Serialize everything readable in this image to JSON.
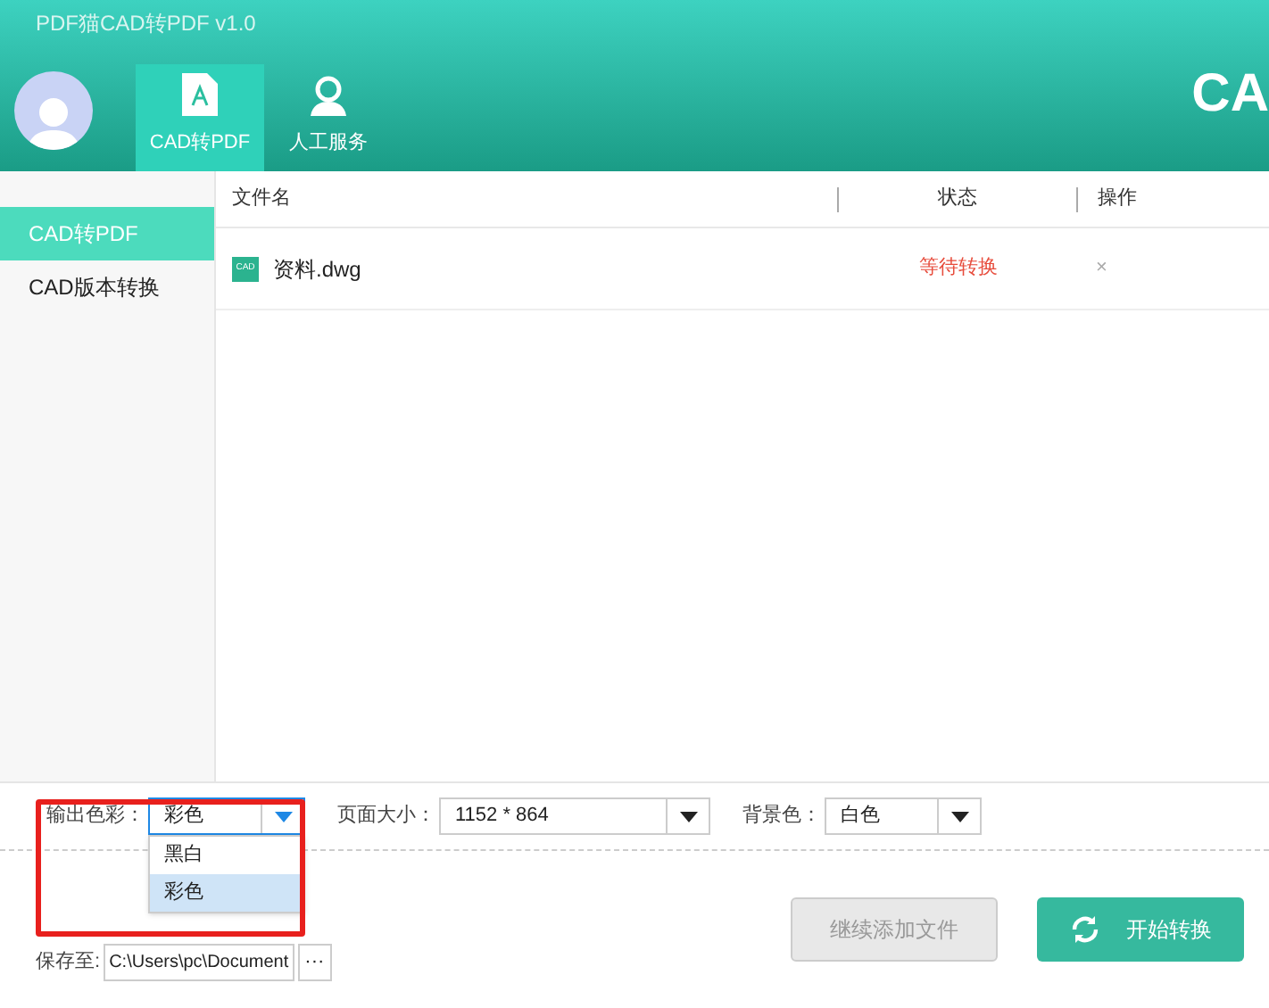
{
  "window": {
    "title": "PDF猫CAD转PDF v1.0"
  },
  "tabs": [
    {
      "label": "CAD转PDF",
      "selected": true
    },
    {
      "label": "人工服务",
      "selected": false
    }
  ],
  "logo": "CA",
  "sidebar": {
    "items": [
      {
        "label": "CAD转PDF",
        "selected": true
      },
      {
        "label": "CAD版本转换",
        "selected": false
      }
    ]
  },
  "table": {
    "columns": [
      "文件名",
      "状态",
      "操作"
    ],
    "rows": [
      {
        "name": "资料.dwg",
        "icon_label": "CAD",
        "status": "等待转换",
        "action": "×"
      }
    ]
  },
  "options": [
    {
      "label": "输出色彩：",
      "value": "彩色",
      "open": true,
      "options": [
        {
          "label": "黑白",
          "selected": false
        },
        {
          "label": "彩色",
          "selected": true
        }
      ]
    },
    {
      "label": "页面大小：",
      "value": "1152 * 864",
      "open": false
    },
    {
      "label": "背景色：",
      "value": "白色",
      "open": false
    }
  ],
  "save": {
    "label": "保存至:",
    "value": "C:\\Users\\pc\\Document",
    "browse": "···"
  },
  "buttons": [
    {
      "label": "继续添加文件",
      "disabled": true
    },
    {
      "label": "开始转换",
      "disabled": false
    }
  ]
}
